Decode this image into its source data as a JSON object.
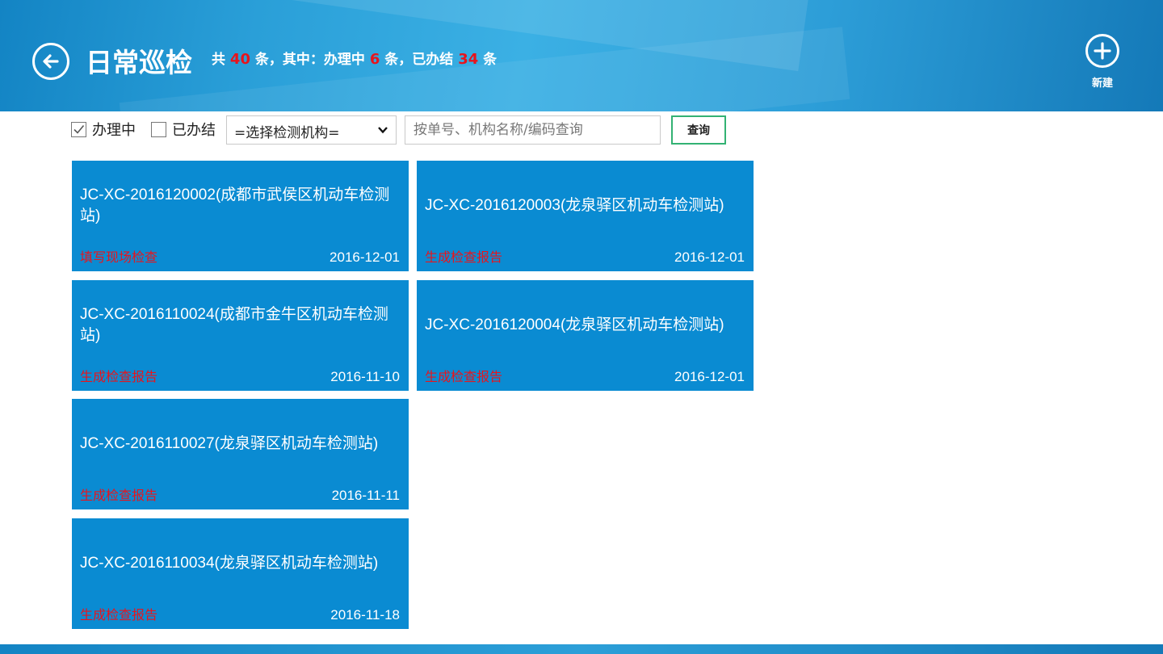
{
  "header": {
    "title": "日常巡检",
    "summary": {
      "total_prefix": "共 ",
      "total": "40",
      "total_suffix": " 条，其中：办理中 ",
      "processing": "6",
      "processing_suffix": " 条，已办结 ",
      "completed": "34",
      "completed_suffix": " 条"
    },
    "new_label": "新建",
    "back_icon": "back-arrow-icon",
    "new_icon": "plus-circle-icon"
  },
  "filter": {
    "processing_label": "办理中",
    "processing_checked": true,
    "completed_label": "已办结",
    "completed_checked": false,
    "org_select_value": "=选择检测机构=",
    "search_placeholder": "按单号、机构名称/编码查询",
    "search_value": "",
    "query_label": "查询"
  },
  "cards": [
    {
      "title": "JC-XC-2016120002(成都市武侯区机动车检测站)",
      "status": "填写现场检查",
      "date": "2016-12-01"
    },
    {
      "title": "JC-XC-2016120003(龙泉驿区机动车检测站)",
      "status": "生成检查报告",
      "date": "2016-12-01"
    },
    {
      "title": "JC-XC-2016110024(成都市金牛区机动车检测站)",
      "status": "生成检查报告",
      "date": "2016-11-10"
    },
    {
      "title": "JC-XC-2016120004(龙泉驿区机动车检测站)",
      "status": "生成检查报告",
      "date": "2016-12-01"
    },
    {
      "title": "JC-XC-2016110027(龙泉驿区机动车检测站)",
      "status": "生成检查报告",
      "date": "2016-11-11"
    },
    {
      "title": "JC-XC-2016110034(龙泉驿区机动车检测站)",
      "status": "生成检查报告",
      "date": "2016-11-18"
    }
  ],
  "colors": {
    "header_blue": "#2a9fd8",
    "card_blue": "#0a8bd2",
    "status_red": "#e8141c",
    "query_border_green": "#33b273"
  }
}
